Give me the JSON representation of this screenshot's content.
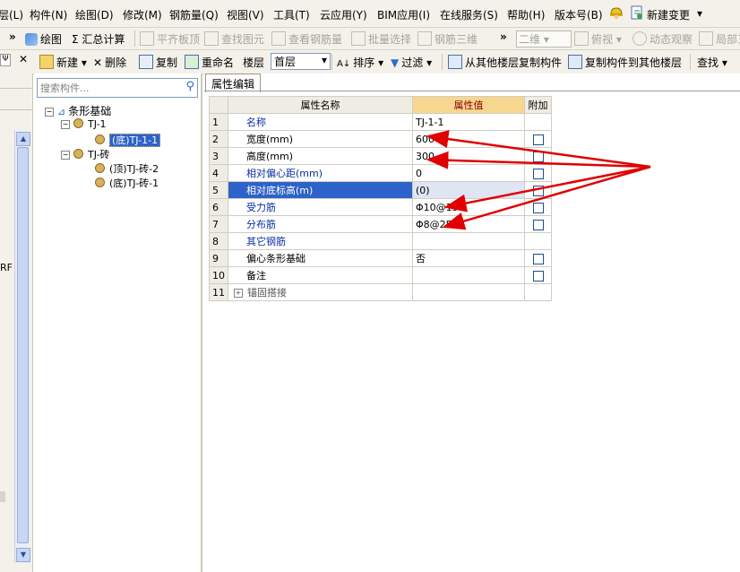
{
  "menubar": {
    "items": [
      "层(L)",
      "构件(N)",
      "绘图(D)",
      "修改(M)",
      "钢筋量(Q)",
      "视图(V)",
      "工具(T)",
      "云应用(Y)",
      "BIM应用(I)",
      "在线服务(S)",
      "帮助(H)",
      "版本号(B)",
      "新建变更"
    ]
  },
  "toolbar1": {
    "items": [
      "»",
      "绘图",
      "Σ 汇总计算",
      "平齐板顶",
      "查找图元",
      "查看钢筋量",
      "批量选择",
      "钢筋三维",
      "»",
      "二维",
      "俯视",
      "动态观察",
      "局部三"
    ]
  },
  "toolbar2": {
    "items": [
      "新建",
      "删除",
      "复制",
      "重命名",
      "楼层",
      "首层",
      "排序",
      "过滤",
      "从其他楼层复制构件",
      "复制构件到其他楼层",
      "查找"
    ]
  },
  "left_panel": {
    "label": "RF"
  },
  "tree": {
    "search_placeholder": "搜索构件...",
    "root": "条形基础",
    "group1": "TJ-1",
    "group1_child": "(底)TJ-1-1",
    "group2": "TJ-砖",
    "group2_child1": "(顶)TJ-砖-2",
    "group2_child2": "(底)TJ-砖-1"
  },
  "tab": {
    "label": "属性编辑"
  },
  "grid": {
    "headers": [
      "属性名称",
      "属性值",
      "附加"
    ],
    "rows": [
      {
        "num": "1",
        "name": "名称",
        "value": "TJ-1-1"
      },
      {
        "num": "2",
        "name": "宽度(mm)",
        "value": "600"
      },
      {
        "num": "3",
        "name": "高度(mm)",
        "value": "300"
      },
      {
        "num": "4",
        "name": "相对偏心距(mm)",
        "value": "0"
      },
      {
        "num": "5",
        "name": "相对底标高(m)",
        "value": "(0)"
      },
      {
        "num": "6",
        "name": "受力筋",
        "value": "Φ10@150"
      },
      {
        "num": "7",
        "name": "分布筋",
        "value": "Φ8@250"
      },
      {
        "num": "8",
        "name": "其它钢筋",
        "value": ""
      },
      {
        "num": "9",
        "name": "偏心条形基础",
        "value": "否"
      },
      {
        "num": "10",
        "name": "备注",
        "value": ""
      },
      {
        "num": "11",
        "name": "锚固搭接",
        "value": ""
      }
    ]
  },
  "colors": {
    "selection": "#2d62c8",
    "header_value": "#f7d690",
    "annotation_arrow": "#e00000"
  }
}
